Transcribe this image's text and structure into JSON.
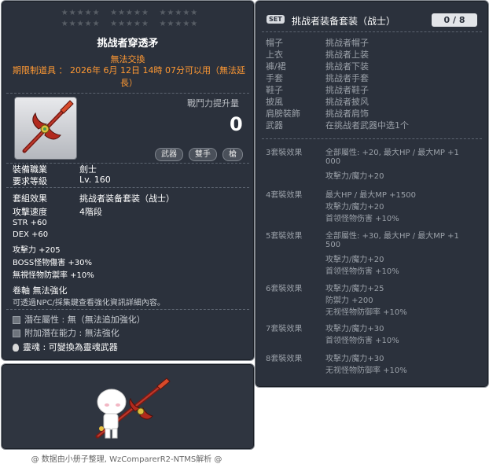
{
  "tooltip_id": "01432239",
  "item": {
    "name": "挑战者穿透矛",
    "trade_status": "無法交換",
    "expire_text": "期限制道具 ： 2026年 6月 12日 14時 07分可以用（無法延長）",
    "power_label": "戰鬥力提升量",
    "power_value": "0",
    "tags": [
      "武器",
      "雙手",
      "槍"
    ],
    "job_label": "裝備職業",
    "job_value": "劍士",
    "req_label": "要求等級",
    "req_value": "Lv. 160",
    "set_label": "套組效果",
    "set_value": "挑战者装备套装（战士）",
    "speed_label": "攻擊速度",
    "speed_value": "4階段",
    "stats": [
      "STR  +60",
      "DEX  +60",
      "攻擊力   +205",
      "BOSS怪物傷害   +30%",
      "無視怪物防禦率   +10%"
    ],
    "scroll_title": "卷軸  無法強化",
    "scroll_desc": "可透過NPC/採集鍵查看強化資訊詳細內容。",
    "potential": "潛在屬性  :  無（無法追加強化）",
    "bonus_potential": "附加潛在能力  :  無法強化",
    "soul": "靈魂  :  可變換為靈魂武器"
  },
  "set": {
    "badge": "SET",
    "title": "挑战者装备套装（战士）",
    "count": "0 / 8",
    "slots": [
      {
        "slot": "帽子",
        "name": "挑战者帽子"
      },
      {
        "slot": "上衣",
        "name": "挑战者上装"
      },
      {
        "slot": "褲/裙",
        "name": "挑战者下装"
      },
      {
        "slot": "手套",
        "name": "挑战者手套"
      },
      {
        "slot": "鞋子",
        "name": "挑战者鞋子"
      },
      {
        "slot": "披風",
        "name": "挑战者披风"
      },
      {
        "slot": "肩膀裝飾",
        "name": "挑战者肩饰"
      },
      {
        "slot": "武器",
        "name": "在挑战者武器中选1个"
      }
    ],
    "bonuses": [
      {
        "label": "3套裝效果",
        "lines": [
          "全部屬性: +20,  最大HP / 最大MP  +1",
          "000",
          "攻擊力/魔力+20"
        ]
      },
      {
        "label": "4套裝效果",
        "lines": [
          "最大HP / 最大MP   +1500",
          "攻擊力/魔力+20",
          "首领怪物伤害  +10%"
        ]
      },
      {
        "label": "5套裝效果",
        "lines": [
          "全部屬性: +30,  最大HP / 最大MP  +1",
          "500",
          "攻擊力/魔力+20",
          "首领怪物伤害  +10%"
        ]
      },
      {
        "label": "6套裝效果",
        "lines": [
          "攻擊力/魔力+25",
          "防禦力   +200",
          "无视怪物防御率  +10%"
        ]
      },
      {
        "label": "7套裝效果",
        "lines": [
          "攻擊力/魔力+30",
          "首领怪物伤害  +10%"
        ]
      },
      {
        "label": "8套裝效果",
        "lines": [
          "攻擊力/魔力+30",
          "无视怪物防御率  +10%"
        ]
      }
    ]
  },
  "credit": "@ 数据由小册子整理, WzComparerR2-NTMS解析 @",
  "colors": {
    "panel": "#2b313c",
    "orange": "#ff9933",
    "muted": "#9aa0a8"
  }
}
